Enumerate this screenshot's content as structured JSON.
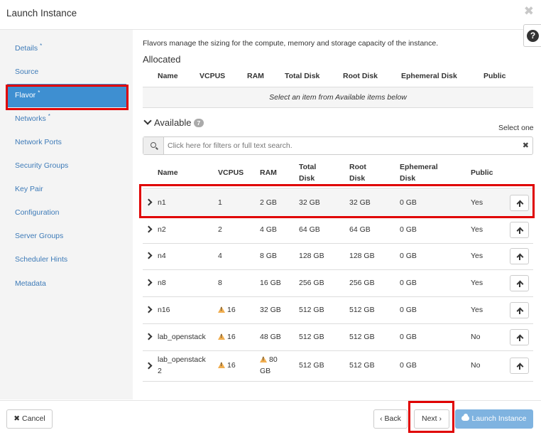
{
  "window": {
    "title": "Launch Instance",
    "close_glyph": "✖"
  },
  "sidebar": {
    "items": [
      {
        "label": "Details",
        "required": "*"
      },
      {
        "label": "Source",
        "required": ""
      },
      {
        "label": "Flavor",
        "required": "*"
      },
      {
        "label": "Networks",
        "required": "*"
      },
      {
        "label": "Network Ports",
        "required": ""
      },
      {
        "label": "Security Groups",
        "required": ""
      },
      {
        "label": "Key Pair",
        "required": ""
      },
      {
        "label": "Configuration",
        "required": ""
      },
      {
        "label": "Server Groups",
        "required": ""
      },
      {
        "label": "Scheduler Hints",
        "required": ""
      },
      {
        "label": "Metadata",
        "required": ""
      }
    ],
    "active_index": 2
  },
  "help": {
    "glyph": "?"
  },
  "main": {
    "intro": "Flavors manage the sizing for the compute, memory and storage capacity of the instance.",
    "allocated": {
      "heading": "Allocated",
      "columns": [
        "Name",
        "VCPUS",
        "RAM",
        "Total Disk",
        "Root Disk",
        "Ephemeral Disk",
        "Public"
      ],
      "empty_message": "Select an item from Available items below"
    },
    "available": {
      "heading": "Available",
      "count": "7",
      "select_hint": "Select one",
      "search_placeholder": "Click here for filters or full text search.",
      "clear_glyph": "✖",
      "columns": [
        {
          "l1": "Name",
          "l2": ""
        },
        {
          "l1": "VCPUS",
          "l2": ""
        },
        {
          "l1": "RAM",
          "l2": ""
        },
        {
          "l1": "Total",
          "l2": "Disk"
        },
        {
          "l1": "Root",
          "l2": "Disk"
        },
        {
          "l1": "Ephemeral",
          "l2": "Disk"
        },
        {
          "l1": "Public",
          "l2": ""
        }
      ],
      "rows": [
        {
          "name": "n1",
          "name2": "",
          "vcpus": "1",
          "vcpus_warn": false,
          "ram": "2 GB",
          "ram2": "",
          "ram_warn": false,
          "total_disk": "32 GB",
          "root_disk": "32 GB",
          "ephemeral_disk": "0 GB",
          "public": "Yes"
        },
        {
          "name": "n2",
          "name2": "",
          "vcpus": "2",
          "vcpus_warn": false,
          "ram": "4 GB",
          "ram2": "",
          "ram_warn": false,
          "total_disk": "64 GB",
          "root_disk": "64 GB",
          "ephemeral_disk": "0 GB",
          "public": "Yes"
        },
        {
          "name": "n4",
          "name2": "",
          "vcpus": "4",
          "vcpus_warn": false,
          "ram": "8 GB",
          "ram2": "",
          "ram_warn": false,
          "total_disk": "128 GB",
          "root_disk": "128 GB",
          "ephemeral_disk": "0 GB",
          "public": "Yes"
        },
        {
          "name": "n8",
          "name2": "",
          "vcpus": "8",
          "vcpus_warn": false,
          "ram": "16 GB",
          "ram2": "",
          "ram_warn": false,
          "total_disk": "256 GB",
          "root_disk": "256 GB",
          "ephemeral_disk": "0 GB",
          "public": "Yes"
        },
        {
          "name": "n16",
          "name2": "",
          "vcpus": "16",
          "vcpus_warn": true,
          "ram": "32 GB",
          "ram2": "",
          "ram_warn": false,
          "total_disk": "512 GB",
          "root_disk": "512 GB",
          "ephemeral_disk": "0 GB",
          "public": "Yes"
        },
        {
          "name": "lab_openstack",
          "name2": "",
          "vcpus": "16",
          "vcpus_warn": true,
          "ram": "48 GB",
          "ram2": "",
          "ram_warn": false,
          "total_disk": "512 GB",
          "root_disk": "512 GB",
          "ephemeral_disk": "0 GB",
          "public": "No"
        },
        {
          "name": "lab_openstack",
          "name2": "2",
          "vcpus": "16",
          "vcpus_warn": true,
          "ram": "80",
          "ram2": "GB",
          "ram_warn": true,
          "total_disk": "512 GB",
          "root_disk": "512 GB",
          "ephemeral_disk": "0 GB",
          "public": "No"
        }
      ]
    }
  },
  "footer": {
    "cancel": {
      "glyph": "✖",
      "label": "Cancel"
    },
    "back": {
      "glyph": "‹",
      "label": "Back"
    },
    "next": {
      "label": "Next",
      "glyph": "›"
    },
    "launch": {
      "label": "Launch Instance"
    }
  },
  "colors": {
    "active_nav": "#3e8fd1",
    "link": "#3e7bb8",
    "highlight": "#e00000",
    "warning": "#f0ad4e",
    "launch_button": "#7fb3e0"
  }
}
